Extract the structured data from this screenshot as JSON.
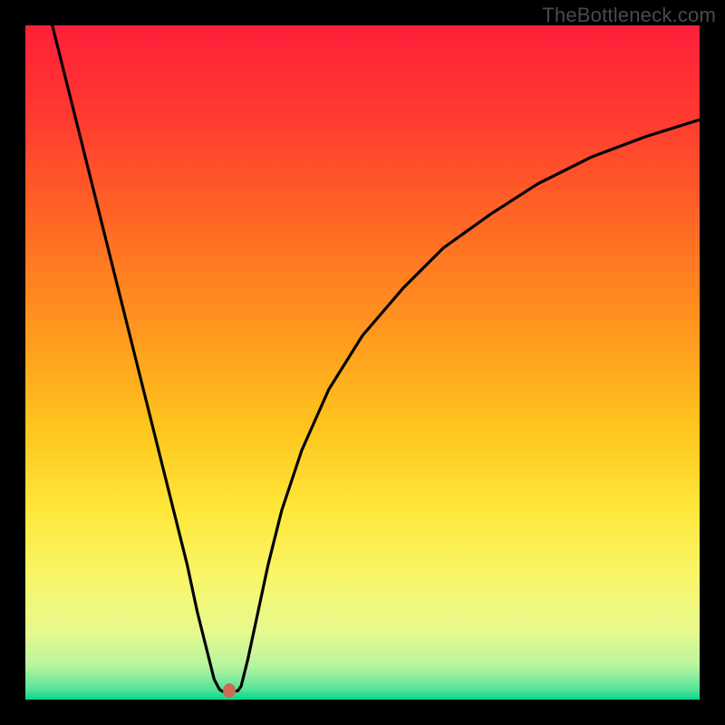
{
  "watermark": "TheBottleneck.com",
  "chart_data": {
    "type": "line",
    "title": "",
    "xlabel": "",
    "ylabel": "",
    "xlim": [
      0,
      100
    ],
    "ylim": [
      0,
      100
    ],
    "gradient_stops": [
      {
        "pos": 0.0,
        "color": "#ff1f3a"
      },
      {
        "pos": 0.14,
        "color": "#ff3b2f"
      },
      {
        "pos": 0.3,
        "color": "#ff6a24"
      },
      {
        "pos": 0.46,
        "color": "#ff9a1e"
      },
      {
        "pos": 0.6,
        "color": "#ffc61e"
      },
      {
        "pos": 0.72,
        "color": "#ffe73a"
      },
      {
        "pos": 0.82,
        "color": "#f8f66a"
      },
      {
        "pos": 0.9,
        "color": "#e6f98e"
      },
      {
        "pos": 0.95,
        "color": "#b7f59f"
      },
      {
        "pos": 0.985,
        "color": "#55e39a"
      },
      {
        "pos": 1.0,
        "color": "#00d98a"
      }
    ],
    "series": [
      {
        "name": "bottleneck-curve",
        "x": [
          4,
          6,
          8,
          10,
          12,
          14,
          16,
          18,
          20,
          22,
          24,
          25.5,
          27,
          28,
          28.8,
          29.3,
          30,
          31.5,
          32,
          33,
          34.5,
          36,
          38,
          41,
          45,
          50,
          56,
          62,
          69,
          76,
          84,
          92,
          100
        ],
        "y": [
          100,
          92,
          84,
          76,
          68,
          60,
          52,
          44,
          36,
          28,
          20,
          13,
          7,
          3,
          1.5,
          1.2,
          1.2,
          1.3,
          2,
          6,
          13,
          20,
          28,
          37,
          46,
          54,
          61,
          67,
          72,
          76.5,
          80.5,
          83.5,
          86
        ]
      }
    ],
    "marker": {
      "x": 30.2,
      "y": 1.4,
      "color": "#cc6a57"
    }
  }
}
